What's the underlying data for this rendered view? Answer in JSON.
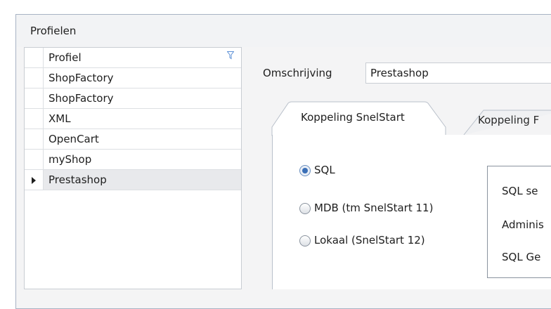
{
  "group": {
    "title": "Profielen"
  },
  "grid": {
    "header": "Profiel",
    "rows": [
      "ShopFactory",
      "ShopFactory",
      "XML",
      "OpenCart",
      "myShop",
      "Prestashop"
    ],
    "selected_index": 5
  },
  "omschrijving": {
    "label": "Omschrijving",
    "value": "Prestashop"
  },
  "tabs": {
    "active": "Koppeling SnelStart",
    "inactive": "Koppeling F"
  },
  "radios": [
    {
      "label": "SQL",
      "checked": true
    },
    {
      "label": "MDB (tm SnelStart 11)",
      "checked": false
    },
    {
      "label": "Lokaal (SnelStart 12)",
      "checked": false
    }
  ],
  "options": [
    "SQL se",
    "Adminis",
    "SQL Ge"
  ],
  "colors": {
    "border": "#a7b3c4",
    "selected_row": "#e8e9ec",
    "radio_accent": "#3a6fb7",
    "filter_icon": "#5b8fd6"
  },
  "icons": {
    "filter": "filter-icon",
    "row_indicator": "triangle-right-icon"
  }
}
